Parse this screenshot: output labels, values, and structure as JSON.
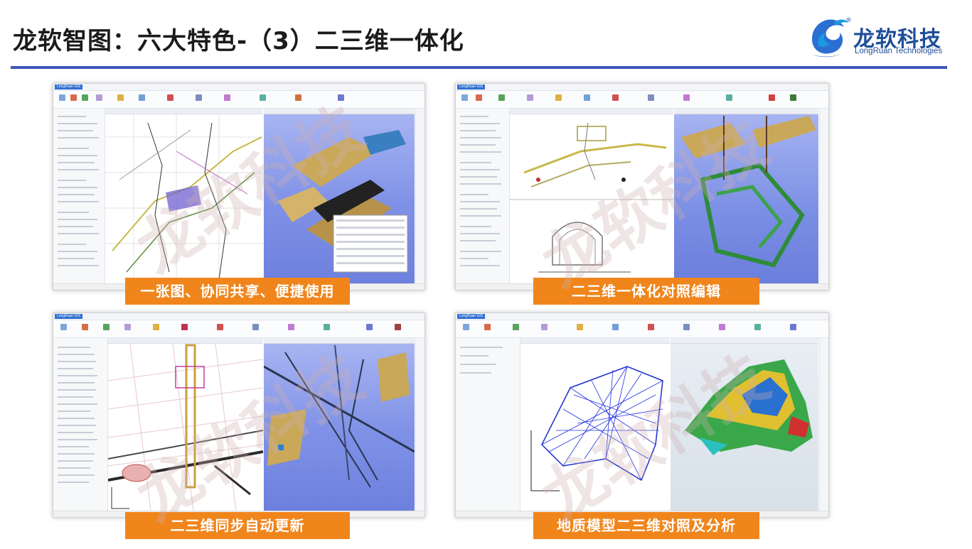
{
  "slide": {
    "title": "龙软智图：六大特色-（3）二三维一体化"
  },
  "brand": {
    "name": "龙软科技",
    "english": "LongRuan Technologies",
    "reg_mark": "®",
    "color": "#1f4e99"
  },
  "rule_color": "#3b58b5",
  "caption_color": "#f0851c",
  "panels": [
    {
      "caption": "一张图、协同共享、便捷使用"
    },
    {
      "caption": "二三维一体化对照编辑"
    },
    {
      "caption": "二三维同步自动更新"
    },
    {
      "caption": "地质模型二三维对照及分析"
    }
  ],
  "app_tag": "LongRuan GIS",
  "watermark": "龙软科技"
}
